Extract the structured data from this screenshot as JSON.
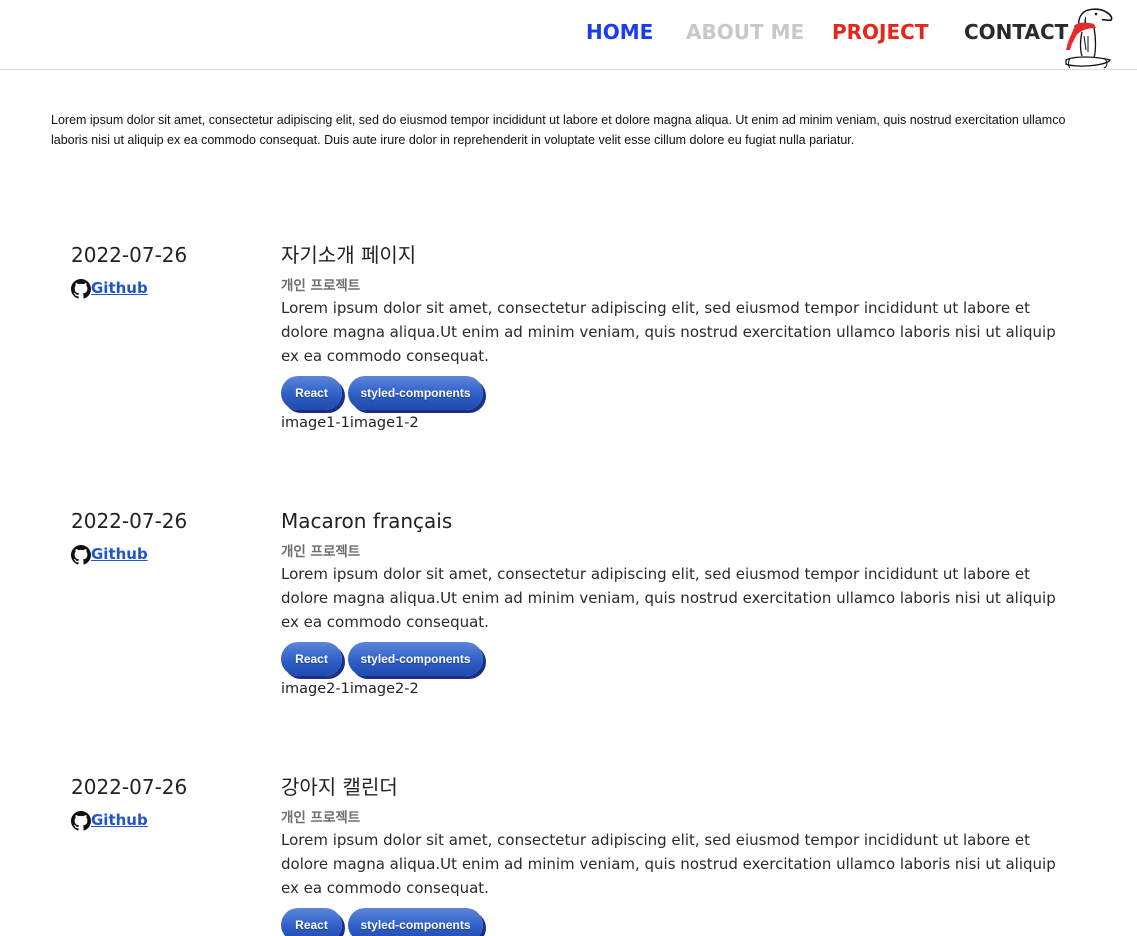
{
  "nav": {
    "home": "HOME",
    "about": "ABOUT ME",
    "project": "PROJECT",
    "contact": "CONTACT",
    "logo_icon": "dog-with-scarf-icon"
  },
  "intro": "Lorem ipsum dolor sit amet, consectetur adipiscing elit, sed do eiusmod tempor incididunt ut labore et dolore magna aliqua. Ut enim ad minim veniam, quis nostrud exercitation ullamco laboris nisi ut aliquip ex ea commodo consequat. Duis aute irure dolor in reprehenderit in voluptate velit esse cillum dolore eu fugiat nulla pariatur.",
  "projects": [
    {
      "date": "2022-07-26",
      "github": "Github",
      "title": "자기소개 페이지",
      "type": "개인 프로젝트",
      "description": "Lorem ipsum dolor sit amet, consectetur adipiscing elit, sed eiusmod tempor incididunt ut labore et dolore magna aliqua.Ut enim ad minim veniam, quis nostrud exercitation ullamco laboris nisi ut aliquip ex ea commodo consequat.",
      "tags": [
        "React",
        "styled-components"
      ],
      "images": "image1-1image1-2"
    },
    {
      "date": "2022-07-26",
      "github": "Github",
      "title": "Macaron français",
      "type": "개인 프로젝트",
      "description": "Lorem ipsum dolor sit amet, consectetur adipiscing elit, sed eiusmod tempor incididunt ut labore et dolore magna aliqua.Ut enim ad minim veniam, quis nostrud exercitation ullamco laboris nisi ut aliquip ex ea commodo consequat.",
      "tags": [
        "React",
        "styled-components"
      ],
      "images": "image2-1image2-2"
    },
    {
      "date": "2022-07-26",
      "github": "Github",
      "title": "강아지 캘린더",
      "type": "개인 프로젝트",
      "description": "Lorem ipsum dolor sit amet, consectetur adipiscing elit, sed eiusmod tempor incididunt ut labore et dolore magna aliqua.Ut enim ad minim veniam, quis nostrud exercitation ullamco laboris nisi ut aliquip ex ea commodo consequat.",
      "tags": [
        "React",
        "styled-components"
      ],
      "images": ""
    }
  ],
  "colors": {
    "nav_home": "#1a3bef",
    "nav_about": "#c8c8c8",
    "nav_project": "#e8241b",
    "nav_contact": "#2a2a2a",
    "link": "#1f56c9",
    "tag": "#2e5fc8"
  }
}
